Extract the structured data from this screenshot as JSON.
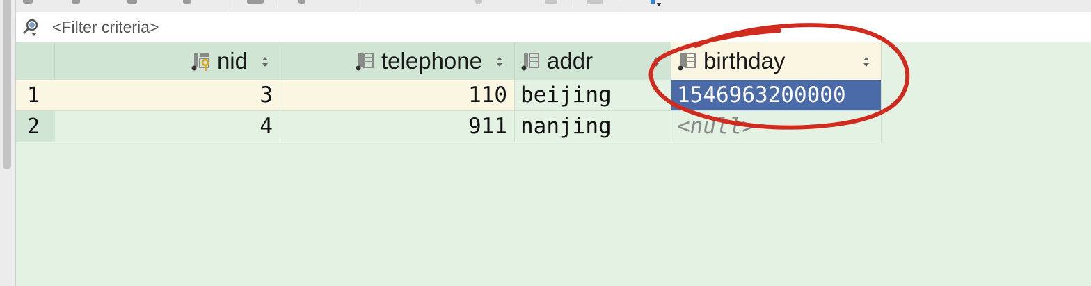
{
  "filter": {
    "placeholder": "<Filter criteria>",
    "icon": "filter-search-icon"
  },
  "table": {
    "columns": [
      {
        "label": "nid",
        "icon": "key-column-icon",
        "align": "right"
      },
      {
        "label": "telephone",
        "icon": "column-icon",
        "align": "right"
      },
      {
        "label": "addr",
        "icon": "column-icon",
        "align": "left"
      },
      {
        "label": "birthday",
        "icon": "column-icon",
        "align": "left"
      }
    ],
    "rows": [
      {
        "num": "1",
        "nid": "3",
        "telephone": "110",
        "addr": "beijing",
        "birthday": "1546963200000"
      },
      {
        "num": "2",
        "nid": "4",
        "telephone": "911",
        "addr": "nanjing",
        "birthday": "<null>"
      }
    ],
    "selected_cell": {
      "row": 1,
      "column": "birthday"
    }
  },
  "annotation": {
    "shape": "freehand-circle",
    "color": "#d12a1f",
    "target": "birthday column"
  },
  "colors": {
    "grid_background": "#e3f2e3",
    "header_background": "#d0e5d3",
    "current_row": "#fbf6e1",
    "selection": "#4a6aa8",
    "null_text": "#8a8a8a"
  }
}
